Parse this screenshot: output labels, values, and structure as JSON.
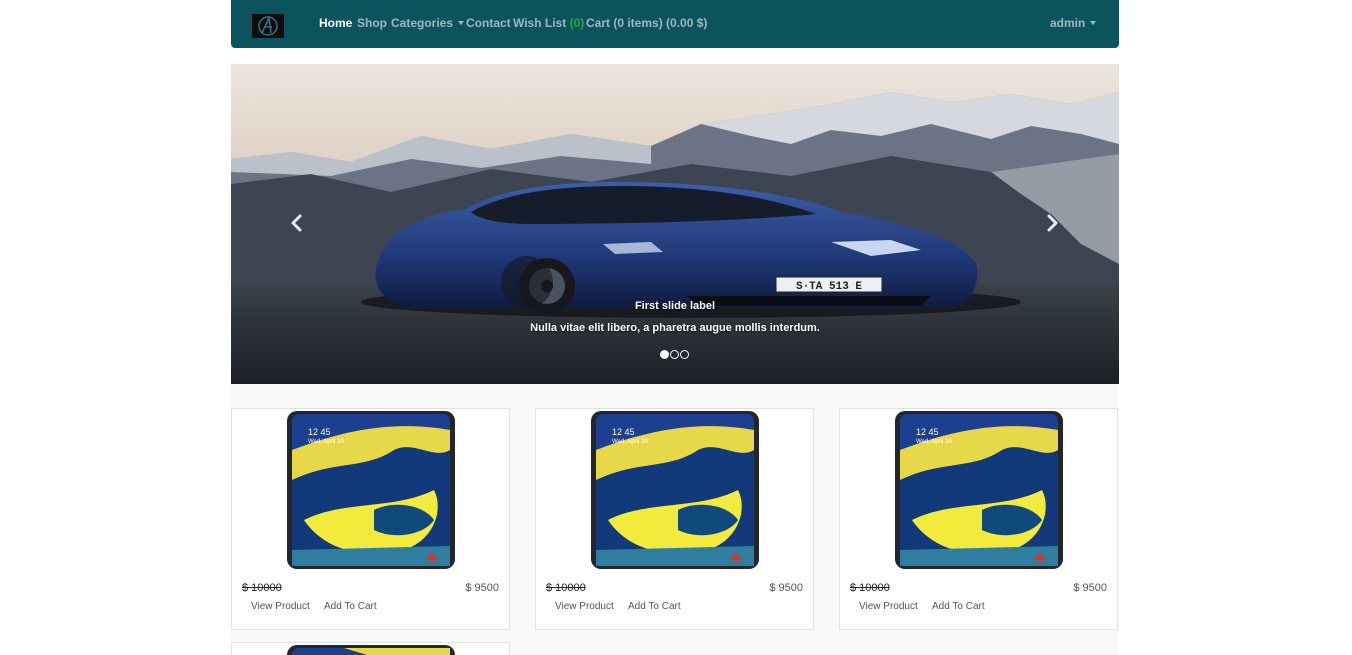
{
  "navbar": {
    "brand_icon": "logo-icon",
    "links": {
      "home": "Home",
      "shop": "Shop",
      "categories": "Categories",
      "contact": "Contact",
      "wishlist": "Wish List",
      "wishlist_count": "(0)",
      "cart": "Cart (0 items) (0.00 $)"
    },
    "user": "admin"
  },
  "carousel": {
    "slide_title": "First slide label",
    "slide_text": "Nulla vitae elit libero, a pharetra augue mollis interdum.",
    "slide_count": 3,
    "active_slide": 1,
    "prev_icon": "chevron-left-icon",
    "next_icon": "chevron-right-icon",
    "plate": "S·TA 513 E"
  },
  "products": [
    {
      "phone_time": "12 45",
      "phone_date": "Wed, April 10",
      "old_price": "$ 10000",
      "price": "$ 9500",
      "view_label": "View Product",
      "cart_label": "Add To Cart"
    },
    {
      "phone_time": "12 45",
      "phone_date": "Wed, April 10",
      "old_price": "$ 10000",
      "price": "$ 9500",
      "view_label": "View Product",
      "cart_label": "Add To Cart"
    },
    {
      "phone_time": "12 45",
      "phone_date": "Wed, April 10",
      "old_price": "$ 10000",
      "price": "$ 9500",
      "view_label": "View Product",
      "cart_label": "Add To Cart"
    },
    {
      "phone_time": "",
      "phone_date": "",
      "old_price": "",
      "price": "",
      "view_label": "",
      "cart_label": ""
    }
  ],
  "colors": {
    "navbar": "#0b535d",
    "nav_text": "#9fb8bc",
    "wishlist_count": "#28a745",
    "page_strip": "#f8f9fa"
  }
}
